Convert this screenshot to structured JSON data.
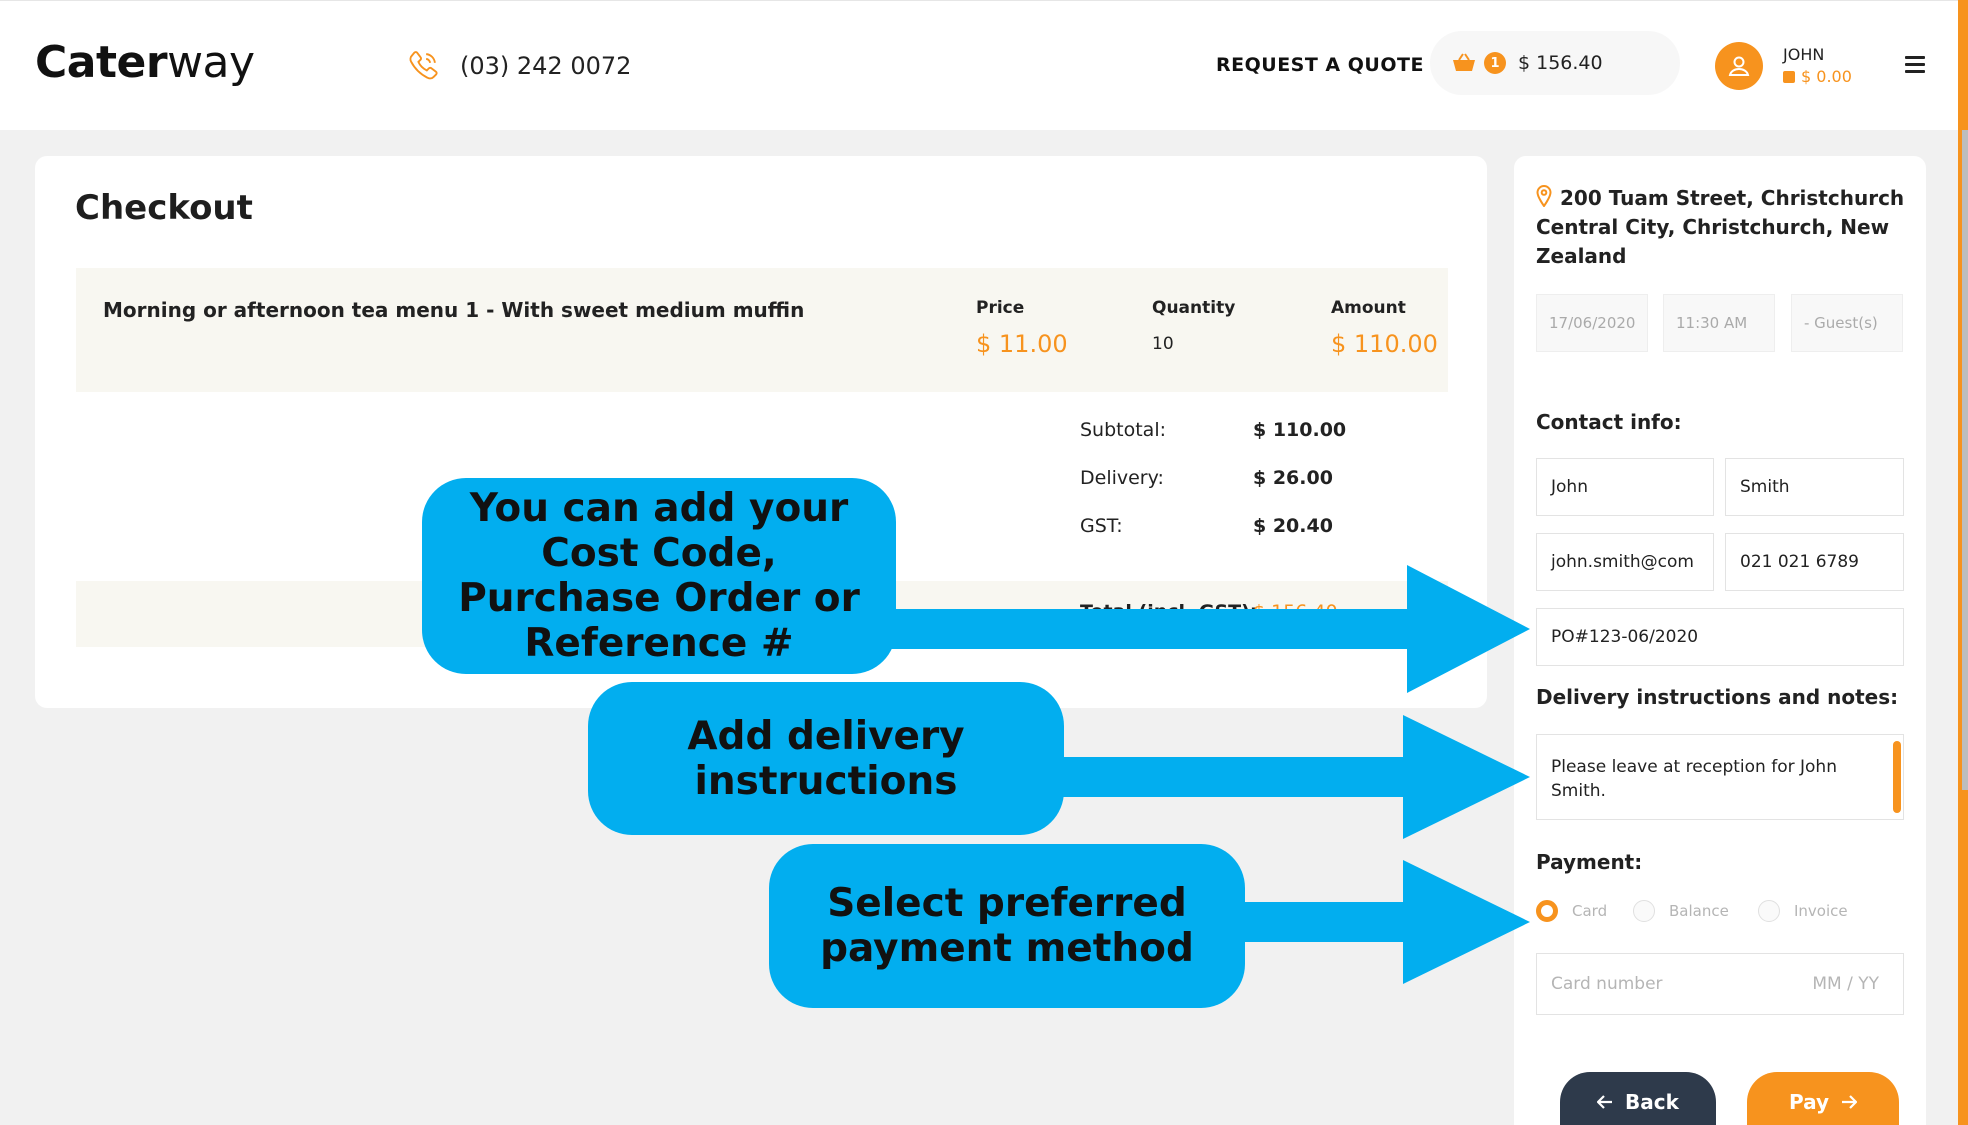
{
  "brand": {
    "logo_bold": "Cater",
    "logo_light": "way",
    "accent": "#f7931e",
    "callout_color": "#02aeef"
  },
  "header": {
    "phone": "(03) 242 0072",
    "request_quote": "REQUEST A QUOTE",
    "cart_count": "1",
    "cart_total": "$ 156.40",
    "user_name": "JOHN",
    "user_balance": "$ 0.00"
  },
  "checkout": {
    "title": "Checkout",
    "item": {
      "name": "Morning or afternoon tea menu 1 - With sweet medium muffin",
      "price_label": "Price",
      "price": "$ 11.00",
      "quantity_label": "Quantity",
      "quantity": "10",
      "amount_label": "Amount",
      "amount": "$ 110.00"
    },
    "summary": {
      "subtotal_label": "Subtotal:",
      "subtotal": "$ 110.00",
      "delivery_label": "Delivery:",
      "delivery": "$ 26.00",
      "gst_label": "GST:",
      "gst": "$ 20.40",
      "total_label": "Total (incl. GST):",
      "total": "$ 156.40"
    }
  },
  "side": {
    "address": "200 Tuam Street, Christchurch Central City, Christchurch, New Zealand",
    "date": "17/06/2020",
    "time": "11:30 AM",
    "guests": "- Guest(s)",
    "contact_title": "Contact info:",
    "first_name": "John",
    "last_name": "Smith",
    "email": "john.smith@com",
    "phone": "021 021 6789",
    "reference": "PO#123-06/2020",
    "notes_title": "Delivery instructions and notes:",
    "notes": "Please leave at reception for John Smith.",
    "payment_title": "Payment:",
    "payment_options": [
      "Card",
      "Balance",
      "Invoice"
    ],
    "selected_payment": "Card",
    "card_placeholder": "Card number",
    "expiry_placeholder": "MM / YY",
    "back_label": "Back",
    "pay_label": "Pay"
  },
  "callouts": {
    "reference": "You can add your Cost Code, Purchase Order or Reference #",
    "delivery": "Add delivery instructions",
    "payment": "Select preferred payment method"
  }
}
